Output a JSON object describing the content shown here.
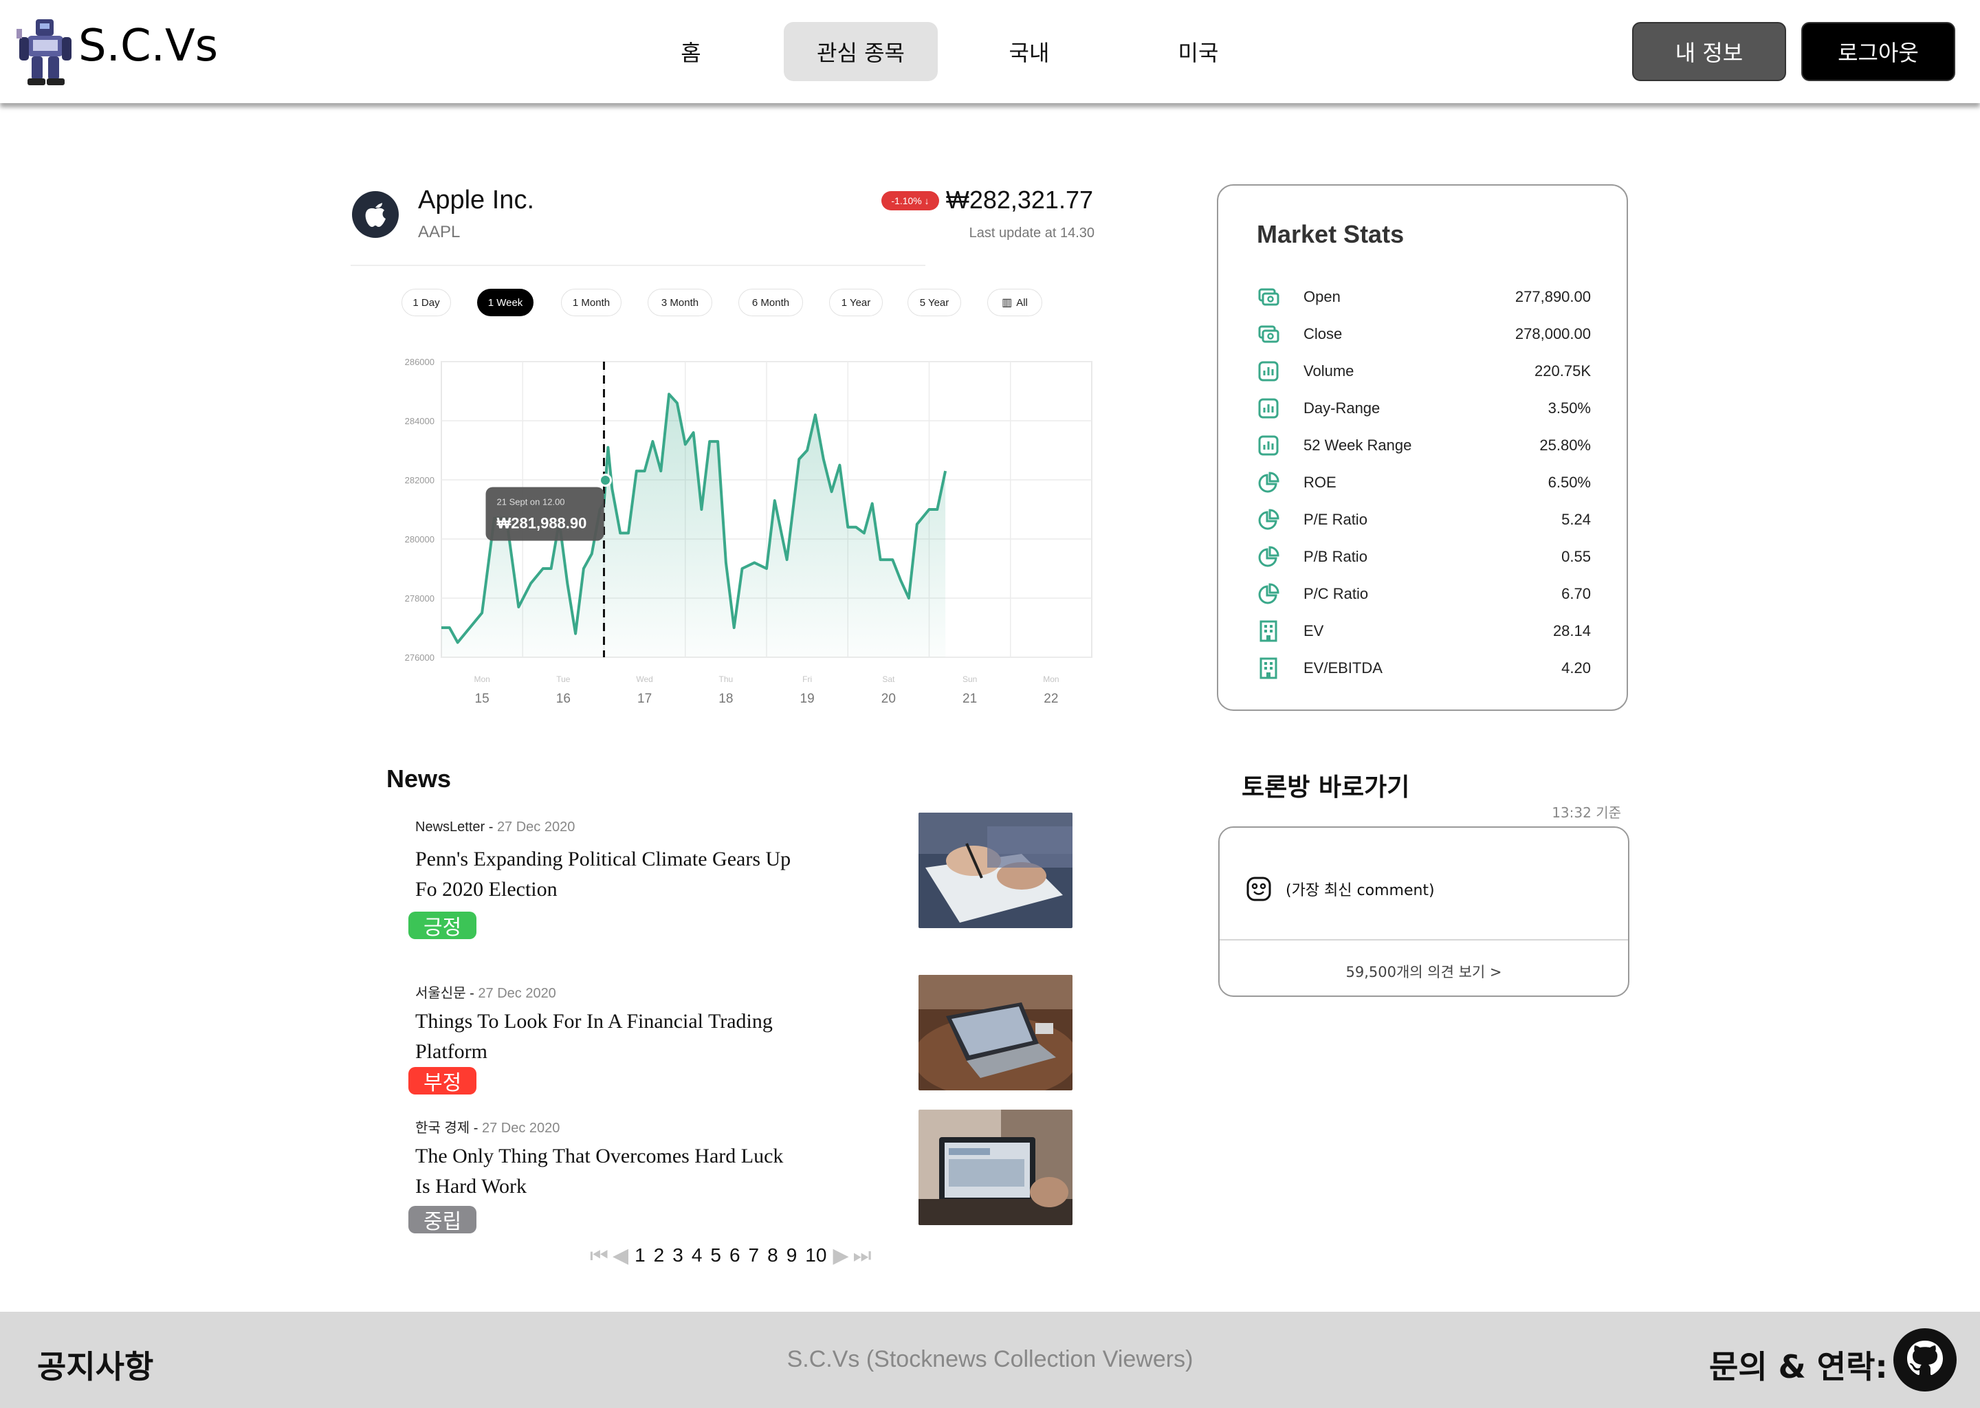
{
  "header": {
    "brand": "S.C.Vs",
    "nav": [
      {
        "label": "홈",
        "active": false
      },
      {
        "label": "관심 종목",
        "active": true
      },
      {
        "label": "국내",
        "active": false
      },
      {
        "label": "미국",
        "active": false
      }
    ],
    "profile_label": "내 정보",
    "logout_label": "로그아웃"
  },
  "stock": {
    "name": "Apple Inc.",
    "ticker": "AAPL",
    "change": "-1.10% ↓",
    "price": "₩282,321.77",
    "last_update": "Last update at 14.30",
    "periods": [
      "1 Day",
      "1 Week",
      "1 Month",
      "3 Month",
      "6 Month",
      "1 Year",
      "5 Year",
      "All"
    ],
    "active_period": "1 Week",
    "colors": {
      "line": "#3aa88a",
      "down": "#e03838"
    }
  },
  "chart_data": {
    "type": "area",
    "y_ticks": [
      "286000",
      "284000",
      "282000",
      "280000",
      "278000",
      "276000"
    ],
    "ylim": [
      276000,
      286000
    ],
    "x_days": [
      "Mon",
      "Tue",
      "Wed",
      "Thu",
      "Fri",
      "Sat",
      "Sun",
      "Mon"
    ],
    "x_dates": [
      "15",
      "16",
      "17",
      "18",
      "19",
      "20",
      "21",
      "22"
    ],
    "x": [
      0.0,
      0.1,
      0.2,
      0.35,
      0.5,
      0.65,
      0.8,
      0.95,
      1.1,
      1.25,
      1.35,
      1.45,
      1.55,
      1.65,
      1.75,
      1.85,
      1.95,
      2.0,
      2.05,
      2.1,
      2.2,
      2.3,
      2.4,
      2.5,
      2.6,
      2.7,
      2.8,
      2.9,
      3.0,
      3.1,
      3.2,
      3.3,
      3.4,
      3.5,
      3.6,
      3.7,
      3.85,
      4.0,
      4.1,
      4.25,
      4.4,
      4.5,
      4.6,
      4.7,
      4.8,
      4.9,
      5.0,
      5.1,
      5.2,
      5.3,
      5.4,
      5.5,
      5.55,
      5.65,
      5.75,
      5.85,
      6.0,
      6.1,
      6.2,
      6.35,
      6.5,
      6.6,
      6.7,
      6.85,
      7.0,
      7.1,
      7.2,
      7.35
    ],
    "values": [
      277000,
      277000,
      276500,
      277000,
      277500,
      280700,
      280700,
      277700,
      278500,
      279000,
      279000,
      280600,
      278500,
      276800,
      279000,
      279500,
      281000,
      281200,
      283100,
      281700,
      280200,
      280200,
      282300,
      282300,
      283300,
      282300,
      284900,
      284600,
      283200,
      283600,
      281000,
      283300,
      283300,
      279200,
      277000,
      279000,
      279200,
      279000,
      281300,
      279300,
      282700,
      283000,
      284200,
      282700,
      281600,
      282500,
      280400,
      280400,
      280200,
      281200,
      279300,
      279300,
      279300,
      278600,
      278000,
      280500,
      281000,
      281000,
      282300
    ],
    "tooltip": {
      "label": "21 Sept on 12.00",
      "value": "₩281,988.90",
      "x": 2.0,
      "y": 281988.9
    }
  },
  "market_stats": {
    "title": "Market Stats",
    "rows": [
      {
        "icon": "money-icon",
        "label": "Open",
        "value": "277,890.00"
      },
      {
        "icon": "money-icon",
        "label": "Close",
        "value": "278,000.00"
      },
      {
        "icon": "bar-chart-icon",
        "label": "Volume",
        "value": "220.75K"
      },
      {
        "icon": "bar-chart-icon",
        "label": "Day-Range",
        "value": "3.50%"
      },
      {
        "icon": "bar-chart-icon",
        "label": "52 Week Range",
        "value": "25.80%"
      },
      {
        "icon": "pie-chart-icon",
        "label": "ROE",
        "value": "6.50%"
      },
      {
        "icon": "pie-chart-icon",
        "label": "P/E Ratio",
        "value": "5.24"
      },
      {
        "icon": "pie-chart-icon",
        "label": "P/B Ratio",
        "value": "0.55"
      },
      {
        "icon": "pie-chart-icon",
        "label": "P/C Ratio",
        "value": "6.70"
      },
      {
        "icon": "building-icon",
        "label": "EV",
        "value": "28.14"
      },
      {
        "icon": "building-icon",
        "label": "EV/EBITDA",
        "value": "4.20"
      }
    ]
  },
  "news": {
    "title": "News",
    "items": [
      {
        "source": "NewsLetter",
        "date": "27 Dec 2020",
        "headline": "Penn's Expanding Political Climate Gears Up Fo 2020 Election",
        "sentiment": "긍정",
        "sentiment_color": "#3cc456"
      },
      {
        "source": "서울신문",
        "date": "27 Dec 2020",
        "headline": "Things To Look For In A Financial Trading Platform",
        "sentiment": "부정",
        "sentiment_color": "#ff3b30"
      },
      {
        "source": "한국 경제",
        "date": "27 Dec 2020",
        "headline": "The Only Thing That Overcomes Hard Luck Is Hard Work",
        "sentiment": "중립",
        "sentiment_color": "#8a8a8e"
      }
    ],
    "pages": [
      "1",
      "2",
      "3",
      "4",
      "5",
      "6",
      "7",
      "8",
      "9",
      "10"
    ]
  },
  "discussion": {
    "title": "토론방 바로가기",
    "time": "13:32 기준",
    "latest_comment": "(가장 최신 comment)",
    "link": "59,500개의 의견 보기 >"
  },
  "footer": {
    "notice": "공지사항",
    "center": "S.C.Vs (Stocknews Collection Viewers)",
    "contact": "문의 & 연락:"
  }
}
